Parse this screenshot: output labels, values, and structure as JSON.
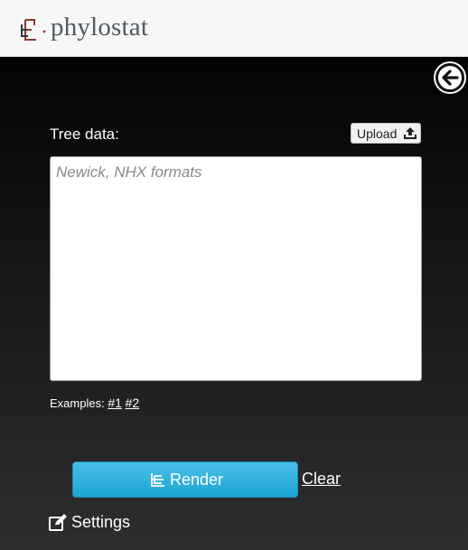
{
  "header": {
    "brand_name": "phylostat",
    "logo_icon": "phylogeny-tree-icon"
  },
  "panel": {
    "collapse_icon": "arrow-left-icon",
    "tree_data_label": "Tree data:",
    "upload_label": "Upload",
    "upload_icon": "upload-icon",
    "tree_input": {
      "value": "",
      "placeholder": "Newick, NHX formats"
    },
    "examples": {
      "label": "Examples:",
      "links": [
        "#1",
        "#2"
      ]
    },
    "render_label": "Render",
    "render_icon": "tree-icon",
    "clear_label": "Clear",
    "settings_label": "Settings",
    "settings_icon": "edit-icon"
  },
  "colors": {
    "panel_dark": "#030303",
    "panel_light": "#2e2e2e",
    "accent": "#2fb0dc",
    "logo_red": "#8a3a32",
    "brand_text": "#505a60"
  }
}
